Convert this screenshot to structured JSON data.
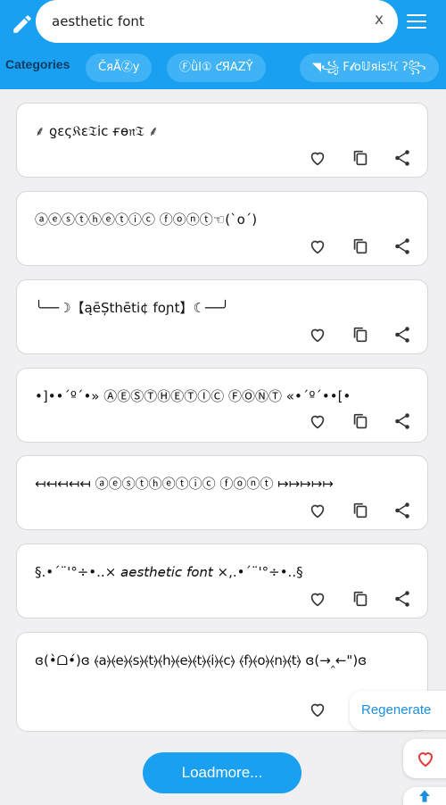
{
  "search": {
    "value": "aesthetic font",
    "clear_label": "x"
  },
  "categories": {
    "label": "Categories",
    "chips": [
      "ČяĂⓏy",
      "Ⓕǜl① ƈЯΑZŶ",
      "◥꧁ F𝓵o𝕌яisℋ ʔ꧂"
    ]
  },
  "cards": [
    {
      "text": "⸙ ƍɛς𝔎ɛ𝔗ⅰc ғɵ𝔫𝔗 ⸙"
    },
    {
      "text": "ⓐⓔⓢⓣⓗⓔⓣⓘⓒ ⓕⓞⓝⓣ☜(`o´)"
    },
    {
      "text": "╰──☽【ąēȘthēti¢ foɲt】☾──╯"
    },
    {
      "text": "•]••´º´•» ⒶⒺⓈⓉⒽⒺⓉⒾⒸ ⒻⓄⓃⓉ «•´º´••[•"
    },
    {
      "text": "↤↤↤↤↤ ⓐⓔⓢⓣⓗⓔⓣⓘⓒ ⓕⓞⓝⓣ ↦↦↦↦↦"
    },
    {
      "text": "§.•´¨'°÷•..× 𝘢𝘦𝘴𝘵𝘩𝘦𝘵𝘪𝘤 𝘧𝘰𝘯𝘵 ×,.•´¨'°÷•..§"
    },
    {
      "text": "ɞ(•̀ᗝ•́)ɞ ⦑a⦒⦑e⦒⦑s⦒⦑t⦒⦑h⦒⦑e⦒⦑t⦒⦑i⦒⦑c⦒ ⦑f⦒⦑o⦒⦑n⦒⦑t⦒ ɞ(→‸←\")ɞ"
    }
  ],
  "buttons": {
    "regenerate": "Regenerate",
    "loadmore": "Loadmore..."
  },
  "colors": {
    "primary": "#1aa0f0",
    "heart": "#e53935",
    "accent_text": "#1a8fe0"
  }
}
